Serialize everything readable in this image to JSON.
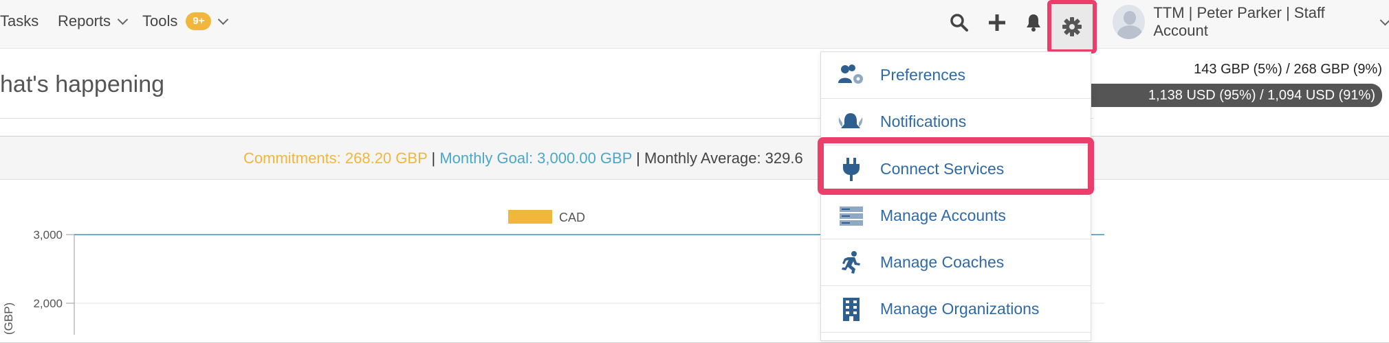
{
  "nav": {
    "tasks": "Tasks",
    "reports": "Reports",
    "tools": "Tools",
    "tools_badge": "9+"
  },
  "user": {
    "label": "TTM | Peter Parker | Staff Account"
  },
  "icons": {
    "search": "search-icon",
    "add": "plus-icon",
    "notifications": "bell-icon",
    "settings": "gear-icon"
  },
  "page": {
    "title": "hat's happening"
  },
  "stats": {
    "line1": "143 GBP (5%) / 268 GBP (9%)",
    "line2": "1,138 USD (95%) / 1,094 USD (91%)"
  },
  "summary": {
    "commitments": "Commitments: 268.20 GBP",
    "separator": "|",
    "goal": "Monthly Goal: 3,000.00 GBP",
    "average": "Monthly Average: 329.6"
  },
  "chart_data": {
    "type": "line",
    "series": [
      {
        "name": "CAD",
        "color": "#f0b73c",
        "values": []
      }
    ],
    "goal_line": 3000,
    "ylabel": "(GBP)",
    "y_ticks": [
      "3,000",
      "2,000"
    ],
    "ylim": [
      0,
      3000
    ]
  },
  "menu": {
    "items": [
      {
        "label": "Preferences",
        "icon": "users-gear-icon"
      },
      {
        "label": "Notifications",
        "icon": "bells-icon"
      },
      {
        "label": "Connect Services",
        "icon": "plug-icon"
      },
      {
        "label": "Manage Accounts",
        "icon": "server-icon"
      },
      {
        "label": "Manage Coaches",
        "icon": "running-person-icon"
      },
      {
        "label": "Manage Organizations",
        "icon": "building-icon"
      }
    ]
  },
  "colors": {
    "accent": "#ea3f6b",
    "link": "#2f6aa6",
    "commitments": "#f0b73c",
    "goal": "#4aa8c6"
  }
}
